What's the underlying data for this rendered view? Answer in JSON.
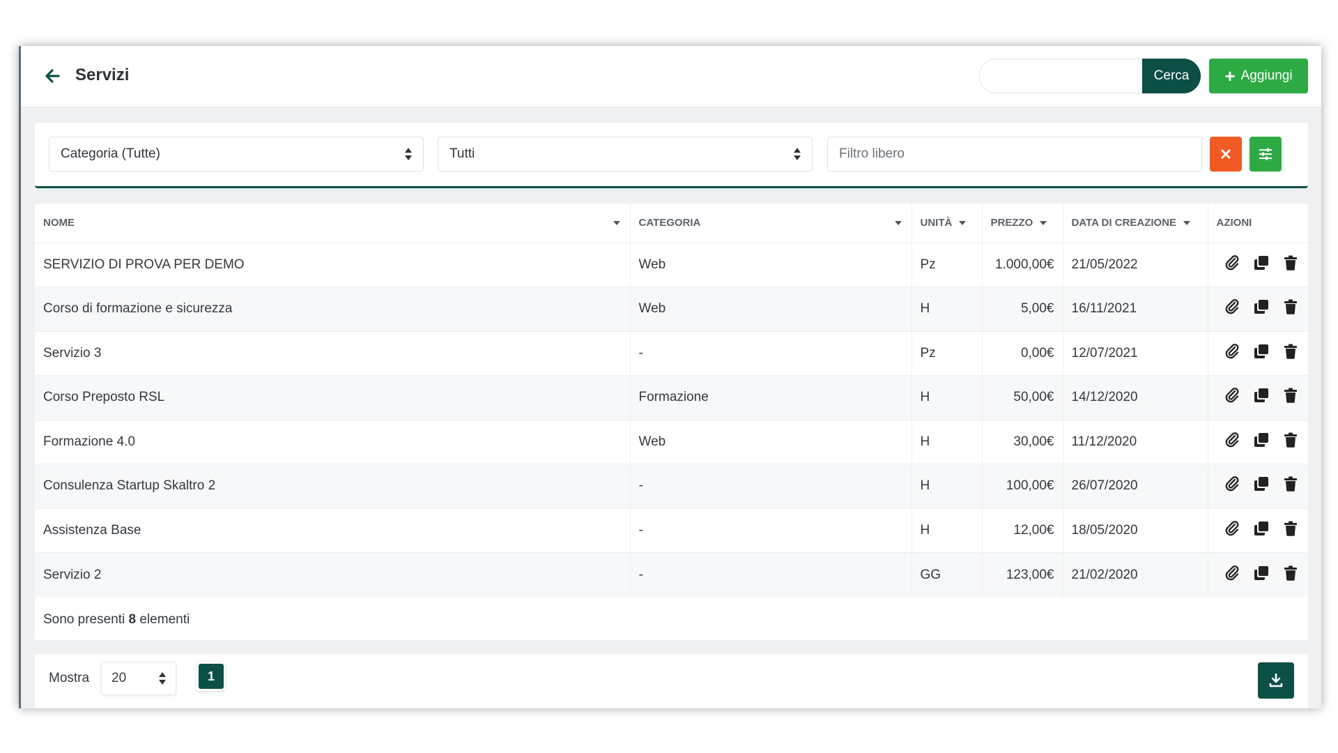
{
  "header": {
    "title": "Servizi",
    "search_placeholder": "",
    "search_label": "Cerca",
    "add_label": "Aggiungi"
  },
  "filters": {
    "category_select": "Categoria (Tutte)",
    "status_select": "Tutti",
    "free_filter_placeholder": "Filtro libero"
  },
  "table": {
    "columns": [
      "Nome",
      "Categoria",
      "Unità",
      "Prezzo",
      "Data di creazione",
      "Azioni"
    ],
    "rows": [
      {
        "nome": "SERVIZIO DI PROVA PER DEMO",
        "categoria": "Web",
        "unita": "Pz",
        "prezzo": "1.000,00€",
        "data": "21/05/2022"
      },
      {
        "nome": "Corso di formazione e sicurezza",
        "categoria": "Web",
        "unita": "H",
        "prezzo": "5,00€",
        "data": "16/11/2021"
      },
      {
        "nome": "Servizio 3",
        "categoria": "-",
        "unita": "Pz",
        "prezzo": "0,00€",
        "data": "12/07/2021"
      },
      {
        "nome": "Corso Preposto RSL",
        "categoria": "Formazione",
        "unita": "H",
        "prezzo": "50,00€",
        "data": "14/12/2020"
      },
      {
        "nome": "Formazione 4.0",
        "categoria": "Web",
        "unita": "H",
        "prezzo": "30,00€",
        "data": "11/12/2020"
      },
      {
        "nome": "Consulenza Startup Skaltro 2",
        "categoria": "-",
        "unita": "H",
        "prezzo": "100,00€",
        "data": "26/07/2020"
      },
      {
        "nome": "Assistenza Base",
        "categoria": "-",
        "unita": "H",
        "prezzo": "12,00€",
        "data": "18/05/2020"
      },
      {
        "nome": "Servizio 2",
        "categoria": "-",
        "unita": "GG",
        "prezzo": "123,00€",
        "data": "21/02/2020"
      }
    ],
    "summary_prefix": "Sono presenti",
    "summary_count": "8",
    "summary_suffix": "elementi"
  },
  "footer": {
    "show_label": "Mostra",
    "page_size": "20",
    "current_page": "1"
  },
  "colors": {
    "primary_dark": "#0c4f47",
    "success": "#2eaa44",
    "danger": "#f15a22"
  },
  "icons": {
    "back": "arrow-left-icon",
    "add": "plus-icon",
    "clear": "close-icon",
    "settings": "sliders-icon",
    "attach": "paperclip-icon",
    "duplicate": "copy-icon",
    "delete": "trash-icon",
    "download": "download-icon"
  }
}
